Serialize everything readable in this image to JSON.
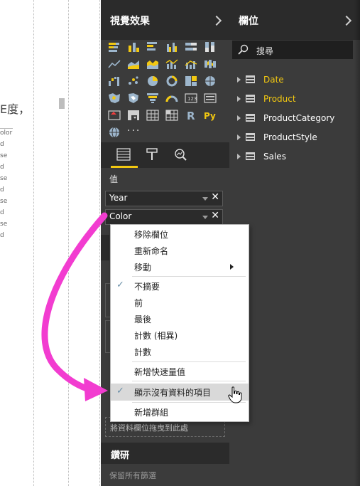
{
  "canvas": {
    "partial_title": "E度，",
    "partial_lines": [
      "olor",
      "d",
      "se",
      "d",
      "se",
      "d",
      "se",
      "d",
      "se",
      "d"
    ]
  },
  "viz_pane": {
    "title": "視覺效果",
    "values_label": "值",
    "fields": [
      {
        "label": "Year"
      },
      {
        "label": "Color"
      }
    ],
    "drop_hint": "將資料欄位拖曳到此處",
    "drill_title": "鑽研",
    "drill_sub": "保留所有篩選"
  },
  "fields_pane": {
    "title": "欄位",
    "search_placeholder": "搜尋",
    "tables": [
      {
        "label": "Date",
        "color": "#f2c811"
      },
      {
        "label": "Product",
        "color": "#f2c811"
      },
      {
        "label": "ProductCategory",
        "color": "#ffffff"
      },
      {
        "label": "ProductStyle",
        "color": "#ffffff"
      },
      {
        "label": "Sales",
        "color": "#ffffff"
      }
    ]
  },
  "context_menu": {
    "items": [
      {
        "label": "移除欄位"
      },
      {
        "label": "重新命名"
      },
      {
        "label": "移動"
      },
      {
        "label": "不摘要",
        "checked": true
      },
      {
        "label": "前"
      },
      {
        "label": "最後"
      },
      {
        "label": "計數 (相異)"
      },
      {
        "label": "計數"
      },
      {
        "label": "新增快速量值"
      },
      {
        "label": "顯示沒有資料的項目",
        "checked": true,
        "highlighted": true
      },
      {
        "label": "新增群組"
      }
    ]
  },
  "colors": {
    "accent_yellow": "#f2c811",
    "arrow_magenta": "#f23cd0",
    "pane_bg": "#3b3b3b",
    "header_bg": "#2b2b2b"
  }
}
